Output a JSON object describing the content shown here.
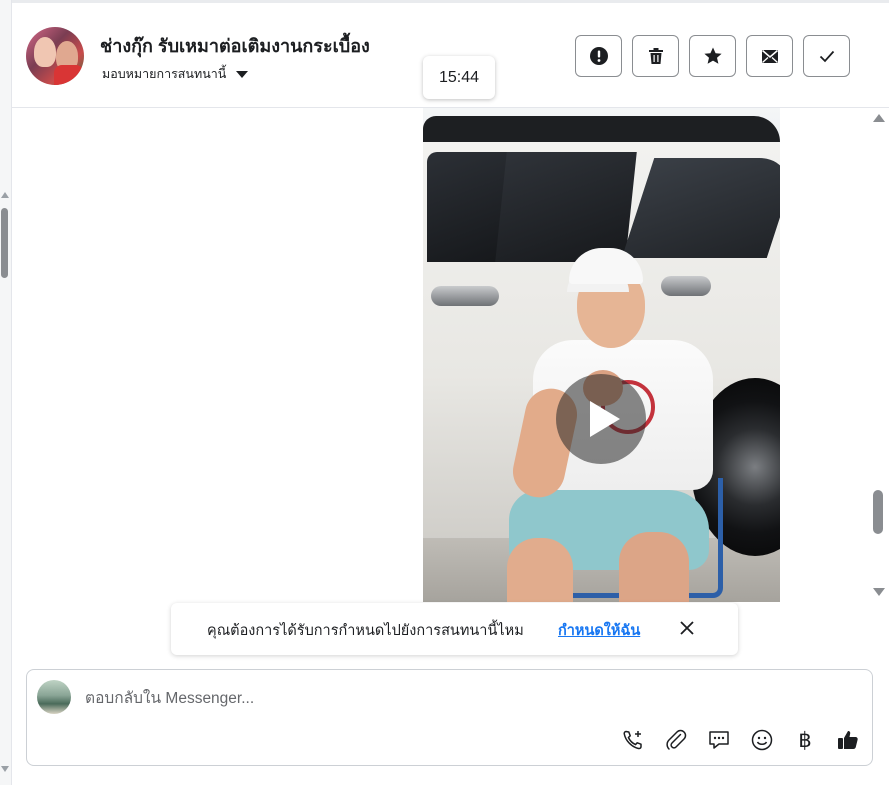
{
  "conversation": {
    "title": "ช่างกุ๊ก รับเหมาต่อเติมงานกระเบื้อง",
    "assign_label": "มอบหมายการสนทนานี้",
    "avatar_icon": "contact-avatar"
  },
  "header_actions": [
    {
      "icon": "alert-icon",
      "label": "spam"
    },
    {
      "icon": "trash-icon",
      "label": "delete"
    },
    {
      "icon": "star-icon",
      "label": "star"
    },
    {
      "icon": "envelope-icon",
      "label": "mark unread"
    },
    {
      "icon": "check-icon",
      "label": "done"
    }
  ],
  "message": {
    "timestamp": "15:44",
    "attachment_type": "video",
    "play_icon": "play-icon"
  },
  "assign_prompt": {
    "text": "คุณต้องการได้รับการกำหนดไปยังการสนทนานี้ไหม",
    "link": "กำหนดให้ฉัน",
    "close_icon": "close-icon"
  },
  "composer": {
    "placeholder": "ตอบกลับใน Messenger...",
    "tools": [
      "call-add-icon",
      "paperclip-icon",
      "saved-reply-icon",
      "emoji-icon",
      "baht-icon",
      "thumbs-up-icon"
    ],
    "currency_symbol": "฿"
  },
  "colors": {
    "link": "#1877f2",
    "border": "#ccd0d5",
    "scroll": "#8a8d91"
  }
}
